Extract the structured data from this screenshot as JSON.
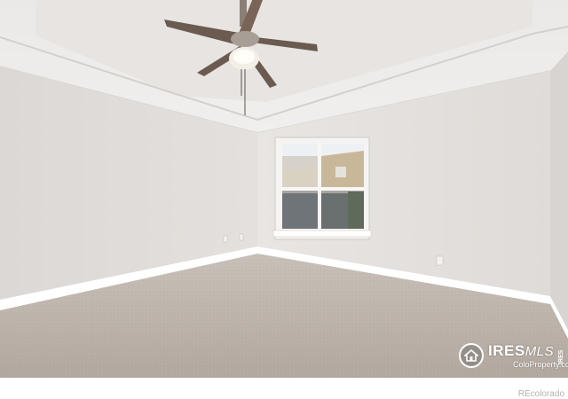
{
  "watermark": {
    "brand": "IRES",
    "brand_suffix": "MLS",
    "sub": "ColoProperty.com",
    "vertical": "IRES"
  },
  "footer": {
    "credit": "REcolorado"
  },
  "colors": {
    "wall_left": "#dedad7",
    "wall_back": "#e6e3e0",
    "ceiling": "#efedeb",
    "carpet": "#bdb4ac",
    "trim": "#ffffff"
  }
}
